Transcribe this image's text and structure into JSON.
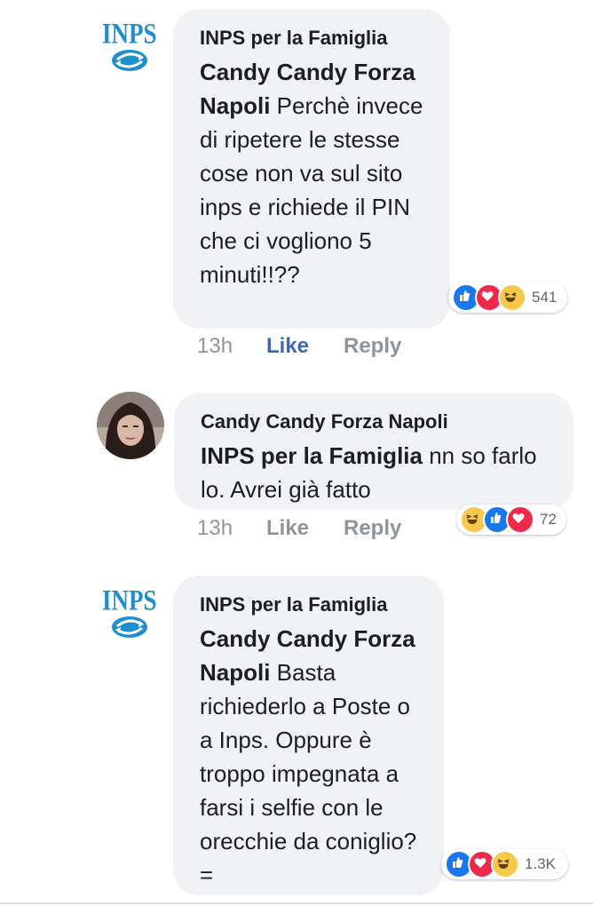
{
  "comments": [
    {
      "author": "INPS per la Famiglia",
      "mention": "Candy Candy Forza Napoli",
      "text": " Perchè invece di ripetere le stesse cose non va sul sito inps e richiede il PIN che ci vogliono 5 minuti!!??",
      "reaction_count": "541",
      "time": "13h",
      "like": "Like",
      "reply": "Reply",
      "avatar_text": "INPS"
    },
    {
      "author": "Candy Candy Forza Napoli",
      "mention": "INPS per la Famiglia",
      "text": " nn so farlo lo. Avrei già fatto",
      "reaction_count": "72",
      "time": "13h",
      "like": "Like",
      "reply": "Reply"
    },
    {
      "author": "INPS per la Famiglia",
      "mention": "Candy Candy Forza Napoli",
      "text": " Basta richiederlo a Poste o a Inps. Oppure è troppo impegnata a farsi i selfie con le orecchie da coniglio?=",
      "reaction_count": "1.3K",
      "avatar_text": "INPS"
    }
  ],
  "colors": {
    "bubble": "#f1f2f6",
    "like_active": "#4267b2",
    "action_grey": "#90949c",
    "like_reaction": "#1877f2",
    "love_reaction": "#f0284a",
    "haha_reaction": "#f7c94b",
    "inps_blue": "#1d8fd1"
  },
  "icons": [
    "inps-logo-icon",
    "like-reaction-icon",
    "love-reaction-icon",
    "haha-reaction-icon"
  ]
}
